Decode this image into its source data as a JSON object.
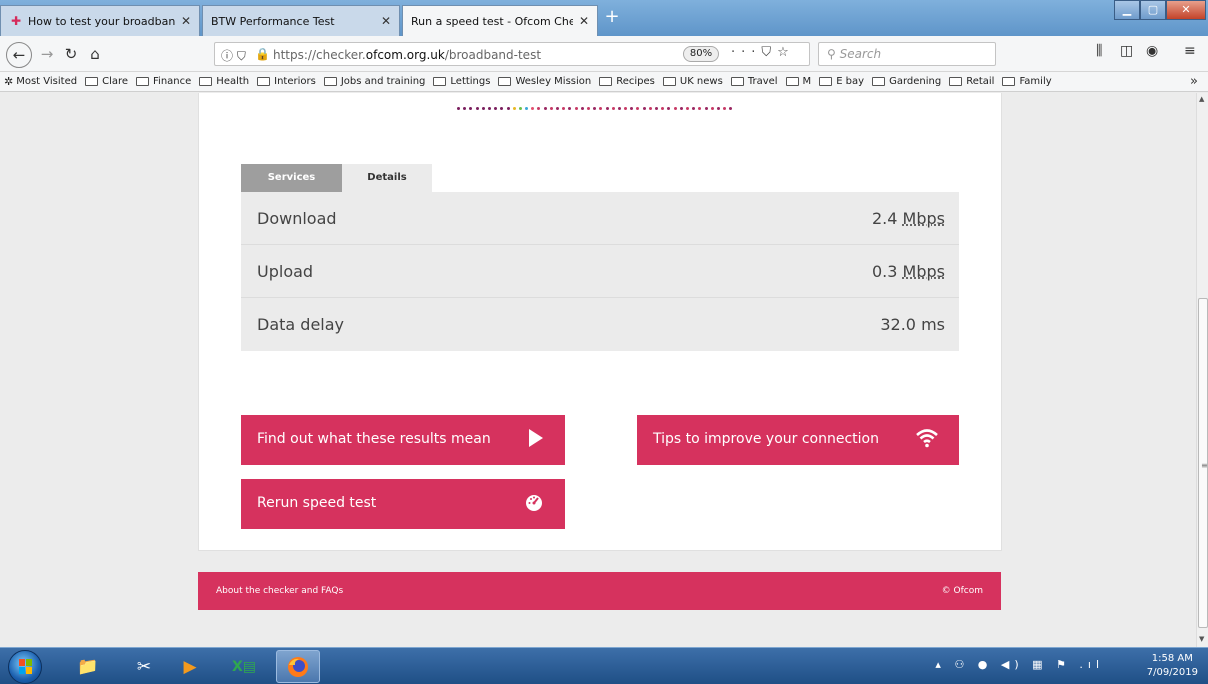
{
  "browser": {
    "tabs": [
      {
        "title": "How to test your broadband sp",
        "active": false
      },
      {
        "title": "BTW Performance Test",
        "active": false
      },
      {
        "title": "Run a speed test - Ofcom Checker",
        "active": true
      }
    ],
    "url_prefix": "https://checker.",
    "url_domain": "ofcom.org.uk",
    "url_path": "/broadband-test",
    "zoom": "80%",
    "search_placeholder": "Search"
  },
  "bookmarks": {
    "most_visited": "Most Visited",
    "folders": [
      "Clare",
      "Finance",
      "Health",
      "Interiors",
      "Jobs and training",
      "Lettings",
      "Wesley Mission",
      "Recipes",
      "UK news",
      "Travel",
      "M",
      "E bay",
      "Gardening",
      "Retail",
      "Family"
    ]
  },
  "page": {
    "tabs": {
      "services": "Services",
      "details": "Details"
    },
    "results": [
      {
        "label": "Download",
        "value": "2.4",
        "unit": "Mbps"
      },
      {
        "label": "Upload",
        "value": "0.3",
        "unit": "Mbps"
      },
      {
        "label": "Data delay",
        "value": "32.0 ms",
        "unit": ""
      }
    ],
    "buttons": {
      "find_out": "Find out what these results mean",
      "tips": "Tips to improve your connection",
      "rerun": "Rerun speed test"
    },
    "footer": {
      "link": "About the checker and FAQs",
      "copyright": "© Ofcom"
    },
    "accent_color": "#d6325e"
  },
  "taskbar": {
    "time": "1:58 AM",
    "date": "7/09/2019"
  }
}
